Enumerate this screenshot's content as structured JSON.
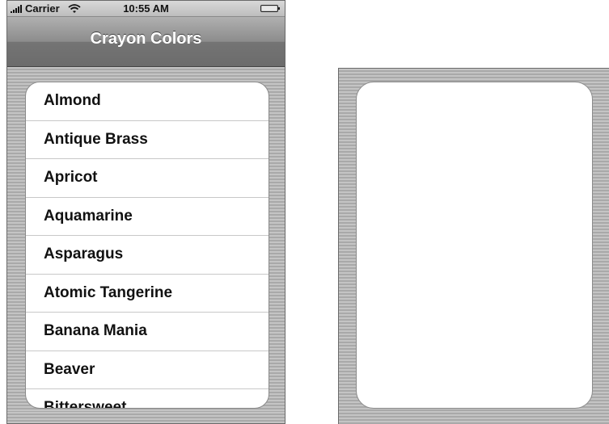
{
  "status_bar": {
    "carrier": "Carrier",
    "time": "10:55 AM",
    "signal_icon": "signal-bars-icon",
    "wifi_icon": "wifi-icon",
    "battery_icon": "battery-icon"
  },
  "nav_bar": {
    "title": "Crayon Colors"
  },
  "crayon_list": {
    "items": [
      {
        "label": "Almond"
      },
      {
        "label": "Antique Brass"
      },
      {
        "label": "Apricot"
      },
      {
        "label": "Aquamarine"
      },
      {
        "label": "Asparagus"
      },
      {
        "label": "Atomic Tangerine"
      },
      {
        "label": "Banana Mania"
      },
      {
        "label": "Beaver"
      },
      {
        "label": "Bittersweet"
      }
    ]
  },
  "detail_view": {
    "background_color": "#ffffff"
  },
  "colors": {
    "nav_bar": "#7a7a7a",
    "pinstripe": "#b6b6b6",
    "list_background": "#ffffff"
  }
}
